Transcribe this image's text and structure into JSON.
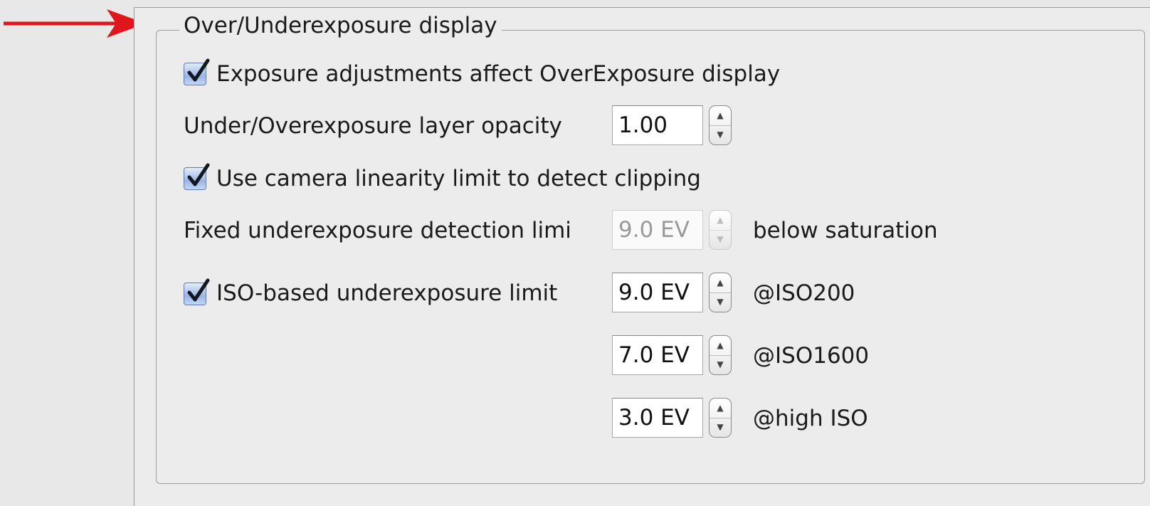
{
  "annotation": {
    "arrow_color": "#e0161c"
  },
  "group": {
    "title": "Over/Underexposure display"
  },
  "rows": {
    "exposure_adjust": {
      "label": "Exposure adjustments affect OverExposure display",
      "checked": true
    },
    "opacity": {
      "label": "Under/Overexposure layer opacity",
      "value": "1.00"
    },
    "linearity": {
      "label": "Use camera linearity limit to detect clipping",
      "checked": true
    },
    "fixed_limit": {
      "label": "Fixed underexposure detection limi",
      "value": "9.0 EV",
      "suffix": "below saturation",
      "enabled": false
    },
    "iso_limit": {
      "label": "ISO-based underexposure limit",
      "checked": true
    },
    "iso200": {
      "value": "9.0 EV",
      "suffix": "@ISO200"
    },
    "iso1600": {
      "value": "7.0 EV",
      "suffix": "@ISO1600"
    },
    "high_iso": {
      "value": "3.0 EV",
      "suffix": "@high ISO"
    }
  },
  "icons": {
    "checkbox": "checkmark-icon",
    "stepper_up": "▲",
    "stepper_down": "▼"
  }
}
